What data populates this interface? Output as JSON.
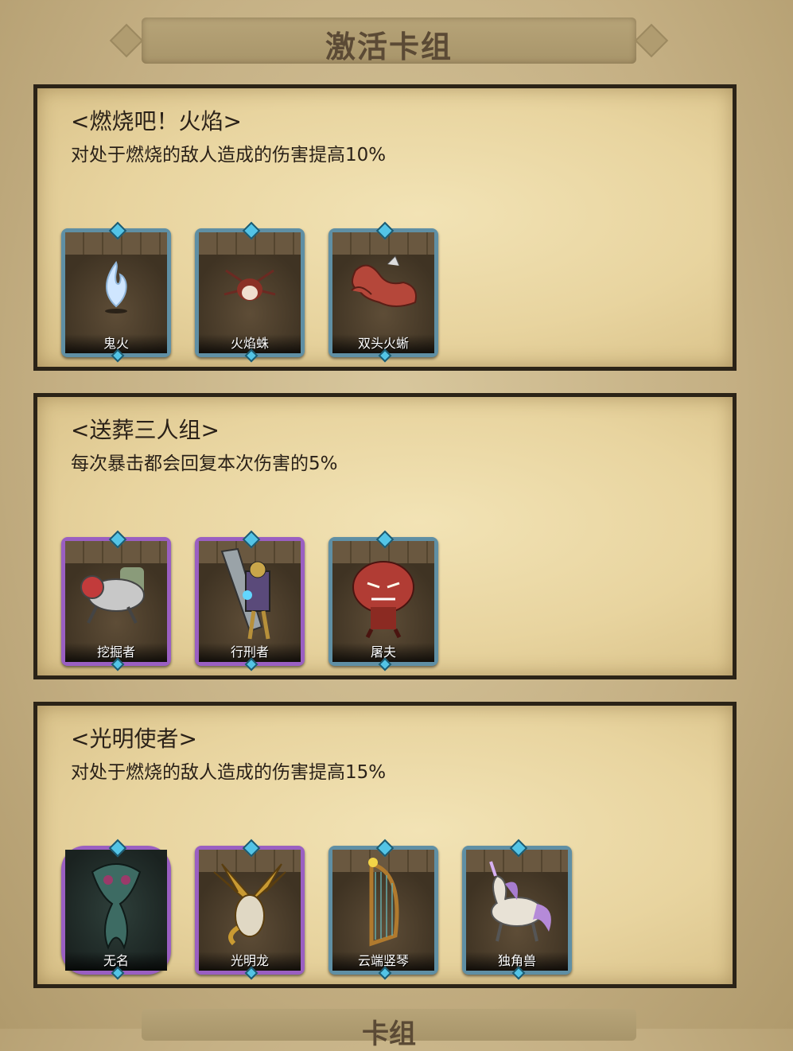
{
  "header": {
    "title": "激活卡组"
  },
  "decks": [
    {
      "name": "<燃烧吧！火焰>",
      "description": "对处于燃烧的敌人造成的伤害提高10%",
      "cards": [
        {
          "name": "鬼火",
          "frame": "blue",
          "icon": "ghost-fire-icon"
        },
        {
          "name": "火焰蛛",
          "frame": "blue",
          "icon": "fire-spider-icon"
        },
        {
          "name": "双头火蜥",
          "frame": "blue",
          "icon": "two-headed-salamander-icon"
        }
      ]
    },
    {
      "name": "<送葬三人组>",
      "description": "每次暴击都会回复本次伤害的5%",
      "cards": [
        {
          "name": "挖掘者",
          "frame": "purple",
          "icon": "digger-icon"
        },
        {
          "name": "行刑者",
          "frame": "purple",
          "icon": "executioner-icon"
        },
        {
          "name": "屠夫",
          "frame": "blue",
          "icon": "butcher-icon"
        }
      ]
    },
    {
      "name": "<光明使者>",
      "description": "对处于燃烧的敌人造成的伤害提高15%",
      "cards": [
        {
          "name": "无名",
          "frame": "purple-hex",
          "icon": "nameless-icon"
        },
        {
          "name": "光明龙",
          "frame": "purple",
          "icon": "light-dragon-icon"
        },
        {
          "name": "云端竖琴",
          "frame": "blue",
          "icon": "cloud-harp-icon"
        },
        {
          "name": "独角兽",
          "frame": "blue",
          "icon": "unicorn-icon"
        }
      ]
    }
  ],
  "footer": {
    "title_partial": "卡组"
  },
  "colors": {
    "blue_frame": "#5f8fa4",
    "purple_frame": "#9a5fc2",
    "gem": "#53c4e6"
  }
}
